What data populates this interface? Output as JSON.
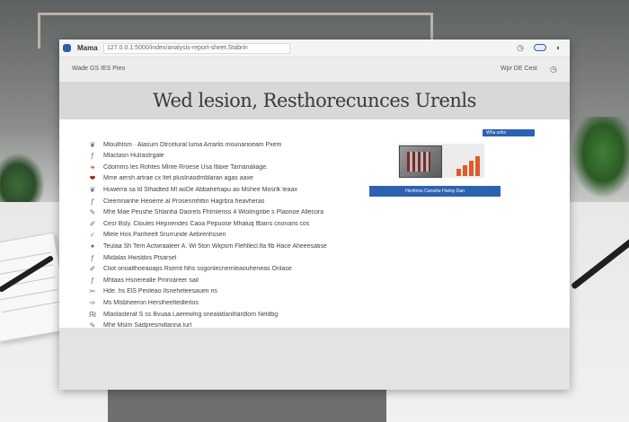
{
  "app": {
    "name": "Mama",
    "url": "127.0.0.1:5000/index/analysis-report-sheet.Stabrin"
  },
  "navbar": {
    "left_text": "Wade GS  IES  Pieo",
    "right_text": "Wpr DE Cest"
  },
  "hero": {
    "title": "Wed lesion, Resthorecunces Urenls"
  },
  "icons": {
    "app": "app-square-icon",
    "top_right": [
      "clock-icon",
      "toggle-icon",
      "eye-icon"
    ],
    "nav_right": "clock-icon"
  },
  "list": [
    {
      "icon": "❦",
      "color": "#6b6b6b",
      "text": "Mloulhtsm  ·  Alasum Dtrcelural luma Arrarlis mounarioeam Pxem"
    },
    {
      "icon": "ƒ",
      "color": "#6b6b6b",
      "text": "Mlactasn  Hulrastrgale"
    },
    {
      "icon": "❧",
      "color": "#c6552a",
      "text": "Cdomms les Rohtes Mlnte Rroese Usa ltlaxe Tarnanaliage."
    },
    {
      "icon": "❤",
      "color": "#a21c1c",
      "text": "Mme aersh artrae cx ltet pluslnaodmblaran agas aaxe"
    },
    {
      "icon": "❦",
      "color": "#6b6b6b",
      "text": "Huwerra sa ld  Slhadted  Ml aoDe Abbahehapu ao Mshee Mosrlk leaax"
    },
    {
      "icon": "ƒ",
      "color": "#6b6b6b",
      "text": "Cleemnanhe  Heoerre al Prosenmhttin Hagrbra heavheras"
    },
    {
      "icon": "✎",
      "color": "#6b6b6b",
      "text": "Mhe Mae  Peushe Shlanha  Daorels Fhlmlenss 4 Wiolmgnbe s Plaonoe Allecora"
    },
    {
      "icon": "✐",
      "color": "#6b6b6b",
      "text": "Cesr Bsly.  Cloules Hepnendes Caoa  Pepuose Mhaluq lfbans cnonans cos"
    },
    {
      "icon": "✓",
      "color": "#6b9e3a",
      "text": "Mlele Hos  Pariheelt  Srurrunde Aebrenhssen"
    },
    {
      "icon": "✦",
      "color": "#6b6b6b",
      "text": "Teulaa Sh  Tern Actwraaleer A. Wi 5ton Wkpsm  Flehllecl.fla  flb Hace  Aheeesatise"
    },
    {
      "icon": "ƒ",
      "color": "#6b6b6b",
      "text": "Mlidalas  Hwsldos Ptsarsel"
    },
    {
      "icon": "✐",
      "color": "#6b6b6b",
      "text": "Cliot  onoalthoeaoaps  Rsemt Nhs ssgonlecnemleaouheneas Onlase"
    },
    {
      "icon": "ƒ",
      "color": "#6b6b6b",
      "text": "Mhtaas  Hsnerealle  Pmnrareer sail"
    },
    {
      "icon": "✂",
      "color": "#6b6b6b",
      "text": "Hde. hs  ElS  Peoleao Ilsneheleesauen ns"
    },
    {
      "icon": "✑",
      "color": "#6b6b6b",
      "text": "Ms Mlsbheeron  Herslheeltedlerlos"
    },
    {
      "icon": "Яℓ",
      "color": "#6b6b6b",
      "text": "Mlaslasteraf  S ss Bvuaa Laerewlng snealatlanlrlardlom Neldbg"
    },
    {
      "icon": "✎",
      "color": "#6b6b6b",
      "text": "Mhe Mslm  Sadpresmiltanna lurl"
    }
  ],
  "card": {
    "tag": "Wha   ssho",
    "button_label": "Hexfoms Carsshe Harlsy Dan"
  }
}
